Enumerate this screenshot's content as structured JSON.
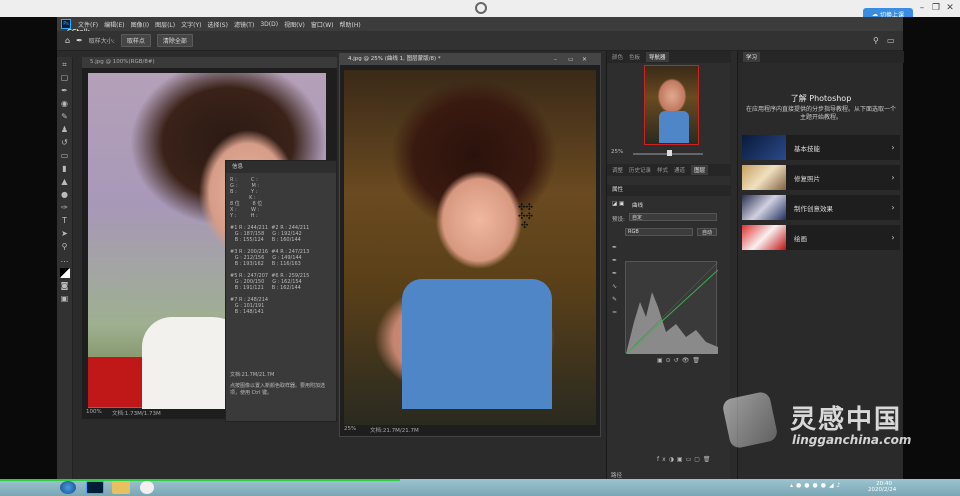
{
  "window": {
    "minimize": "–",
    "maximize": "❐",
    "close": "✕",
    "cc_badge": "切换上课"
  },
  "ps": {
    "cctalk": "CCtalk",
    "menu": [
      "文件(F)",
      "编辑(E)",
      "图像(I)",
      "图层(L)",
      "文字(Y)",
      "选择(S)",
      "滤镜(T)",
      "3D(D)",
      "视图(V)",
      "窗口(W)",
      "帮助(H)"
    ],
    "options": {
      "sample_size_label": "取样大小:",
      "sample_size_value": "取样点",
      "clear_all": "清除全部"
    }
  },
  "doc1": {
    "tab": "5.jpg @ 100%(RGB/8#)",
    "zoom": "100%",
    "status": "文档:1.73M/1.73M"
  },
  "doc2": {
    "tab": "4.jpg @ 25% (曲线 1, 图层蒙版/8) *",
    "zoom": "25%",
    "status": "文档:21.7M/21.7M"
  },
  "info": {
    "header": "信息",
    "rows": [
      "R :         C :",
      "G :         M :",
      "B :         Y :",
      "            K :",
      "8 位        8 位",
      "X :         W :",
      "Y :         H :",
      "#1 R : 244/211  #2 R : 244/211",
      "   G : 187/158     G : 192/142",
      "   B : 155/124     B : 160/144",
      "#3 R : 200/216  #4 R : 247/213",
      "   G : 212/156     G : 149/144",
      "   B : 193/162     B : 116/163",
      "#5 R : 247/207  #6 R : 259/215",
      "   G : 200/150     G : 162/154",
      "   B : 191/121     B : 162/144",
      "#7 R : 248/214",
      "   G : 101/191",
      "   B : 148/141"
    ],
    "doc_size": "文档:21.7M/21.7M",
    "hint": "点按图像以置入新颜色取样器。要用附加选项，使用 Ctrl 键。"
  },
  "panels": {
    "nav_tabs": [
      "颜色",
      "色板",
      "导航器"
    ],
    "nav_zoom": "25%",
    "adj_tabs": [
      "调整",
      "历史记录",
      "样式",
      "通道",
      "图层"
    ],
    "props_header": "属性",
    "props_curves": "曲线",
    "preset_label": "预设:",
    "preset_value": "自定",
    "channel_value": "RGB",
    "auto_btn": "自动",
    "bottom_label": "路径"
  },
  "learn": {
    "tab": "学习",
    "title": "了解 Photoshop",
    "description": "在应用程序内直接提供的分步指导教程。从下面选取一个主题开始教程。",
    "cards": [
      {
        "label": "基本技能"
      },
      {
        "label": "修复照片"
      },
      {
        "label": "制作创意效果"
      },
      {
        "label": "绘画"
      }
    ]
  },
  "watermark": {
    "cn": "灵感中国",
    "en": "lingganchina.com"
  },
  "taskbar": {
    "time": "20:40",
    "date": "2020/2/24"
  }
}
